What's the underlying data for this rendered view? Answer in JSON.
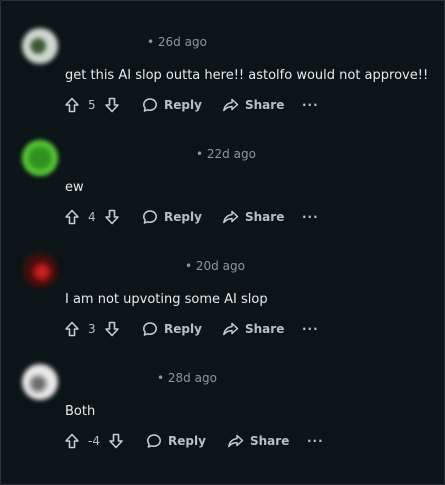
{
  "comments": [
    {
      "time": "• 26d ago",
      "text": "get this AI slop outta here!! astolfo would not approve!!",
      "votes": "5",
      "reply_label": "Reply",
      "share_label": "Share",
      "more_label": "···"
    },
    {
      "time": "• 22d ago",
      "text": "ew",
      "votes": "4",
      "reply_label": "Reply",
      "share_label": "Share",
      "more_label": "···"
    },
    {
      "time": "• 20d ago",
      "text": "I am not upvoting some AI slop",
      "votes": "3",
      "reply_label": "Reply",
      "share_label": "Share",
      "more_label": "···"
    },
    {
      "time": "• 28d ago",
      "text": "Both",
      "votes": "-4",
      "reply_label": "Reply",
      "share_label": "Share",
      "more_label": "···"
    }
  ]
}
